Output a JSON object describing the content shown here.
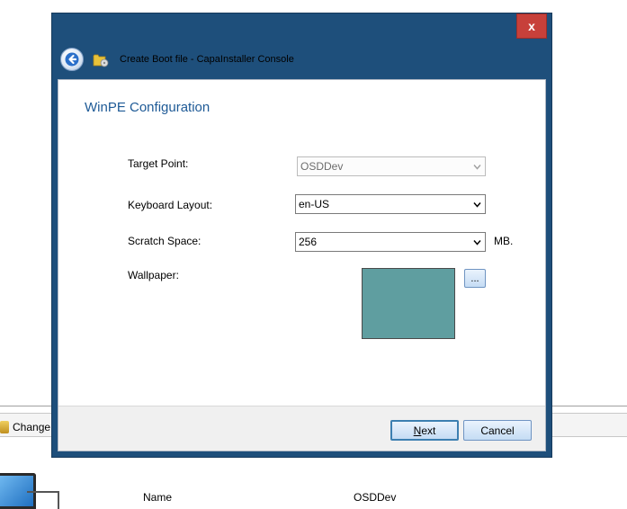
{
  "background_app": {
    "toolbar_change_label": "Change",
    "details": {
      "name_label": "Name",
      "name_value": "OSDDev"
    }
  },
  "window": {
    "title": "Create Boot file - CapaInstaller Console",
    "close_label": "x",
    "back_icon": "back-arrow-icon",
    "app_icon": "folder-cd-icon"
  },
  "page": {
    "heading": "WinPE Configuration",
    "fields": {
      "target_point": {
        "label": "Target Point:",
        "value": "OSDDev",
        "disabled": true
      },
      "keyboard_layout": {
        "label": "Keyboard Layout:",
        "value": "en-US"
      },
      "scratch_space": {
        "label": "Scratch Space:",
        "value": "256",
        "unit": "MB."
      },
      "wallpaper": {
        "label": "Wallpaper:",
        "color": "#5f9ea0",
        "browse_label": "..."
      }
    }
  },
  "footer": {
    "next_mnemonic": "N",
    "next_rest": "ext",
    "cancel_label": "Cancel"
  },
  "colors": {
    "window_frame": "#1e4f7b",
    "close_button": "#c7403a",
    "heading": "#1e5a96"
  }
}
